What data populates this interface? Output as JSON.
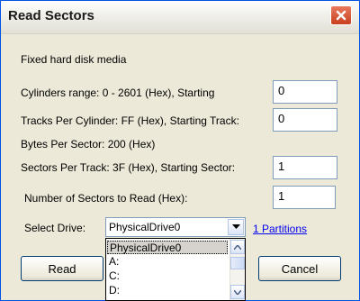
{
  "window": {
    "title": "Read Sectors"
  },
  "info": {
    "media": "Fixed hard disk media",
    "cylinders_label": "Cylinders range: 0 - 2601 (Hex), Starting",
    "cylinders_value": "0",
    "tracks_label": "Tracks Per Cylinder:  FF (Hex), Starting Track:",
    "tracks_value": "0",
    "bytes_label": "Bytes Per Sector:  200 (Hex)",
    "sectors_label": "Sectors Per Track:  3F (Hex), Starting Sector:",
    "sectors_value": "1",
    "count_label": "Number of Sectors to Read (Hex):",
    "count_value": "1"
  },
  "drive": {
    "label": "Select Drive:",
    "selected": "PhysicalDrive0",
    "partitions_link": "1 Partitions",
    "options": [
      "PhysicalDrive0",
      "A:",
      "C:",
      "D:"
    ]
  },
  "buttons": {
    "read": "Read",
    "cancel": "Cancel"
  },
  "icons": {
    "close": "close-icon",
    "dropdown": "chevron-down-icon"
  }
}
